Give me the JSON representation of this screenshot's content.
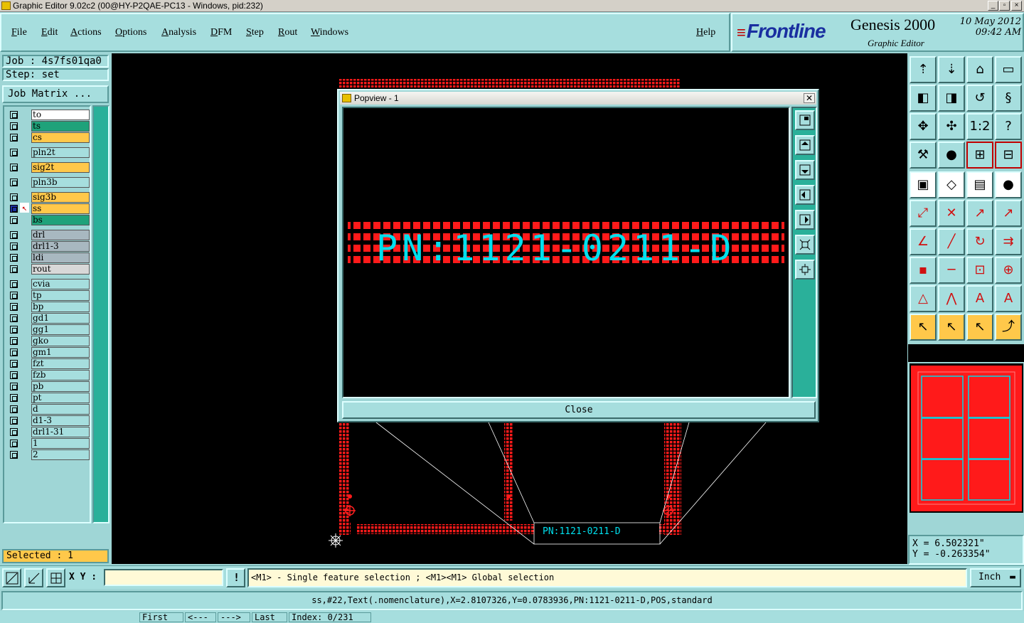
{
  "window": {
    "title": "Graphic Editor 9.02c2 (00@HY-P2QAE-PC13 - Windows, pid:232)"
  },
  "menu": [
    "File",
    "Edit",
    "Actions",
    "Options",
    "Analysis",
    "DFM",
    "Step",
    "Rout",
    "Windows"
  ],
  "help": "Help",
  "brand": {
    "logo": "Frontline",
    "product": "Genesis 2000",
    "subtitle": "Graphic Editor",
    "date": "10 May 2012",
    "time": "09:42 AM"
  },
  "job": {
    "job": "Job : 4s7fs01qa0",
    "step": "Step: set",
    "matrix_button": "Job Matrix ..."
  },
  "layers": [
    {
      "name": "to",
      "color": "#ffffff"
    },
    {
      "name": "ts",
      "color": "#1fa27a"
    },
    {
      "name": "cs",
      "color": "#ffc84a"
    },
    {
      "name": "pln2t",
      "color": "#a6dede"
    },
    {
      "name": "sig2t",
      "color": "#ffc84a"
    },
    {
      "name": "pln3b",
      "color": "#a6dede"
    },
    {
      "name": "sig3b",
      "color": "#ffc84a"
    },
    {
      "name": "ss",
      "color": "#ffc84a"
    },
    {
      "name": "bs",
      "color": "#1fa27a"
    },
    {
      "name": "drl",
      "color": "#a8b8c0"
    },
    {
      "name": "drl1-3",
      "color": "#a8b8c0"
    },
    {
      "name": "ldi",
      "color": "#a8b8c0"
    },
    {
      "name": "rout",
      "color": "#d8d8d8"
    },
    {
      "name": "cvia",
      "color": "#a6dede"
    },
    {
      "name": "tp",
      "color": "#a6dede"
    },
    {
      "name": "bp",
      "color": "#a6dede"
    },
    {
      "name": "gd1",
      "color": "#a6dede"
    },
    {
      "name": "gg1",
      "color": "#a6dede"
    },
    {
      "name": "gko",
      "color": "#a6dede"
    },
    {
      "name": "gm1",
      "color": "#a6dede"
    },
    {
      "name": "fzt",
      "color": "#a6dede"
    },
    {
      "name": "fzb",
      "color": "#a6dede"
    },
    {
      "name": "pb",
      "color": "#a6dede"
    },
    {
      "name": "pt",
      "color": "#a6dede"
    },
    {
      "name": "d",
      "color": "#a6dede"
    },
    {
      "name": "d1-3",
      "color": "#a6dede"
    },
    {
      "name": "drl1-31",
      "color": "#a6dede"
    },
    {
      "name": "1",
      "color": "#a6dede"
    },
    {
      "name": "2",
      "color": "#a6dede"
    }
  ],
  "selected": "Selected : 1",
  "popview": {
    "title": "Popview - 1",
    "text": "PN:1121-0211-D",
    "close": "Close"
  },
  "board_text": "PN:1121-0211-D",
  "coords": {
    "x": "X  =  6.502321\"",
    "y": "Y  = -0.263354\""
  },
  "xy_label": "X Y :",
  "xy_value": "",
  "prompt": "<M1> - Single feature selection ; <M1><M1> Global selection",
  "unit": "Inch",
  "status": "ss,#22,Text(.nomenclature),X=2.8107326,Y=0.0783936,PN:1121-0211-D,POS,standard",
  "bottom_cut": [
    "First",
    "<---",
    "--->",
    "Last",
    "Index: 0/231"
  ],
  "colors": {
    "pad": "#ff1a1a",
    "text": "#00e0ee",
    "panel": "#a6dede",
    "highlight": "#ffc84a"
  }
}
